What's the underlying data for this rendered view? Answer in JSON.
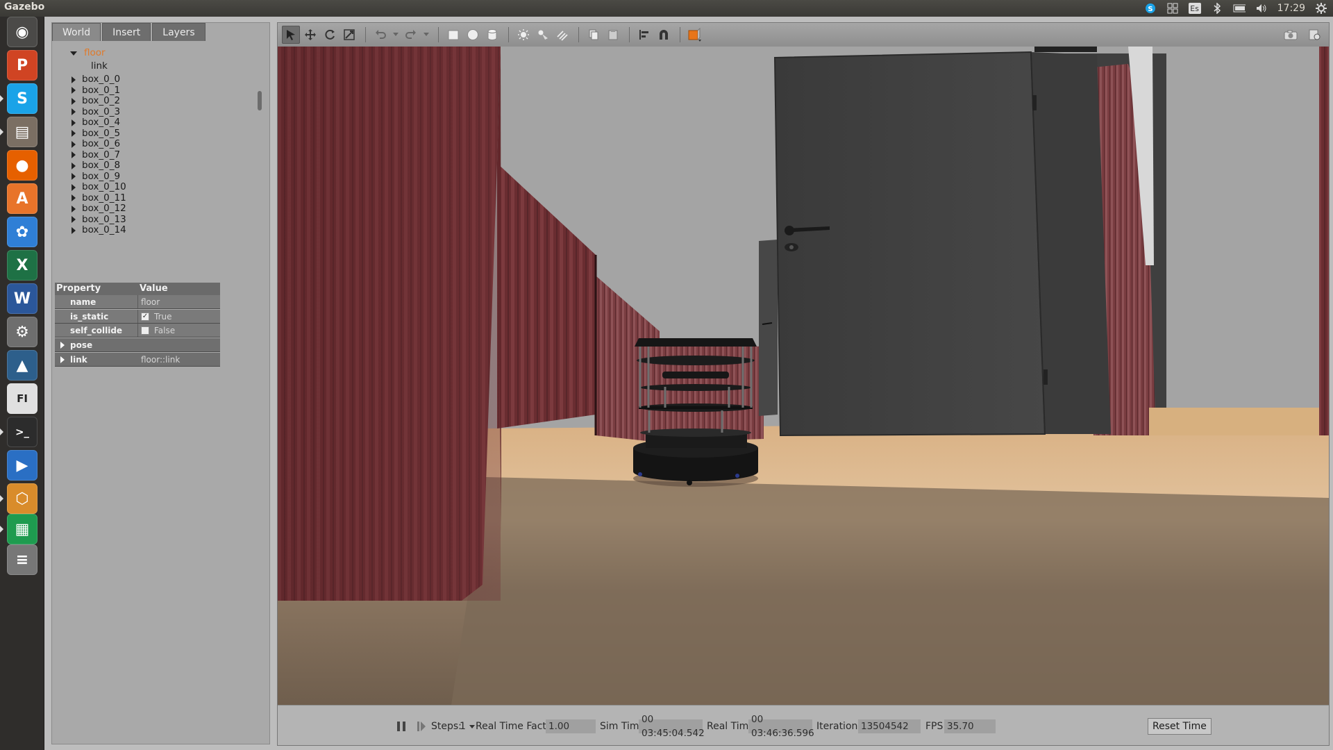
{
  "topbar": {
    "app_title": "Gazebo",
    "keyboard_layout": "Es",
    "clock": "17:29"
  },
  "launcher": {
    "items": [
      {
        "name": "ubuntu-home",
        "glyph": "◉",
        "color": "#4b4a48"
      },
      {
        "name": "powerpoint",
        "glyph": "P",
        "color": "#d04423"
      },
      {
        "name": "skype",
        "glyph": "S",
        "color": "#1aa3e8"
      },
      {
        "name": "file-manager",
        "glyph": "▤",
        "color": "#7b6f63"
      },
      {
        "name": "firefox",
        "glyph": "●",
        "color": "#e66000"
      },
      {
        "name": "software-center",
        "glyph": "A",
        "color": "#e8742a"
      },
      {
        "name": "crossover",
        "glyph": "✿",
        "color": "#2f7fd6"
      },
      {
        "name": "excel",
        "glyph": "X",
        "color": "#1e7145"
      },
      {
        "name": "word",
        "glyph": "W",
        "color": "#2b579a"
      },
      {
        "name": "system-settings",
        "glyph": "⚙",
        "color": "#6e6e6e"
      },
      {
        "name": "matlab",
        "glyph": "▲",
        "color": "#2d5f8b"
      },
      {
        "name": "document-editor",
        "glyph": "FI",
        "color": "#e0e0e0"
      },
      {
        "name": "terminal",
        "glyph": ">_",
        "color": "#2c2c2c"
      },
      {
        "name": "media-player",
        "glyph": "▶",
        "color": "#2a6fc4"
      },
      {
        "name": "virtualbox",
        "glyph": "⬡",
        "color": "#d98c2b"
      },
      {
        "name": "spreadsheet",
        "glyph": "▦",
        "color": "#1e9b4f"
      },
      {
        "name": "trash",
        "glyph": "≡",
        "color": "#777777"
      }
    ]
  },
  "left_panel": {
    "tabs": [
      "World",
      "Insert",
      "Layers"
    ],
    "tree": {
      "selected": "floor",
      "child": "link",
      "models": [
        "box_0_0",
        "box_0_1",
        "box_0_2",
        "box_0_3",
        "box_0_4",
        "box_0_5",
        "box_0_6",
        "box_0_7",
        "box_0_8",
        "box_0_9",
        "box_0_10",
        "box_0_11",
        "box_0_12",
        "box_0_13",
        "box_0_14"
      ]
    },
    "properties": {
      "col_property": "Property",
      "col_value": "Value",
      "name_key": "name",
      "name_val": "floor",
      "is_static_key": "is_static",
      "is_static_val": "True",
      "self_collide_key": "self_collide",
      "self_collide_val": "False",
      "pose_key": "pose",
      "link_key": "link",
      "link_val": "floor::link"
    }
  },
  "bottombar": {
    "steps_label": "Steps:",
    "steps_value": "1",
    "rtf_label": "Real Time Factor:",
    "rtf_value": "1.00",
    "sim_label": "Sim Time:",
    "sim_value": "00 03:45:04.542",
    "real_label": "Real Time:",
    "real_value": "00 03:46:36.596",
    "iter_label": "Iterations:",
    "iter_value": "13504542",
    "fps_label": "FPS:",
    "fps_value": "35.70",
    "reset_label": "Reset Time"
  },
  "colors": {
    "selected_text": "#e07a2a",
    "wall": "#6e2f33",
    "floor": "#c8a882",
    "door": "#3f3f3f"
  }
}
